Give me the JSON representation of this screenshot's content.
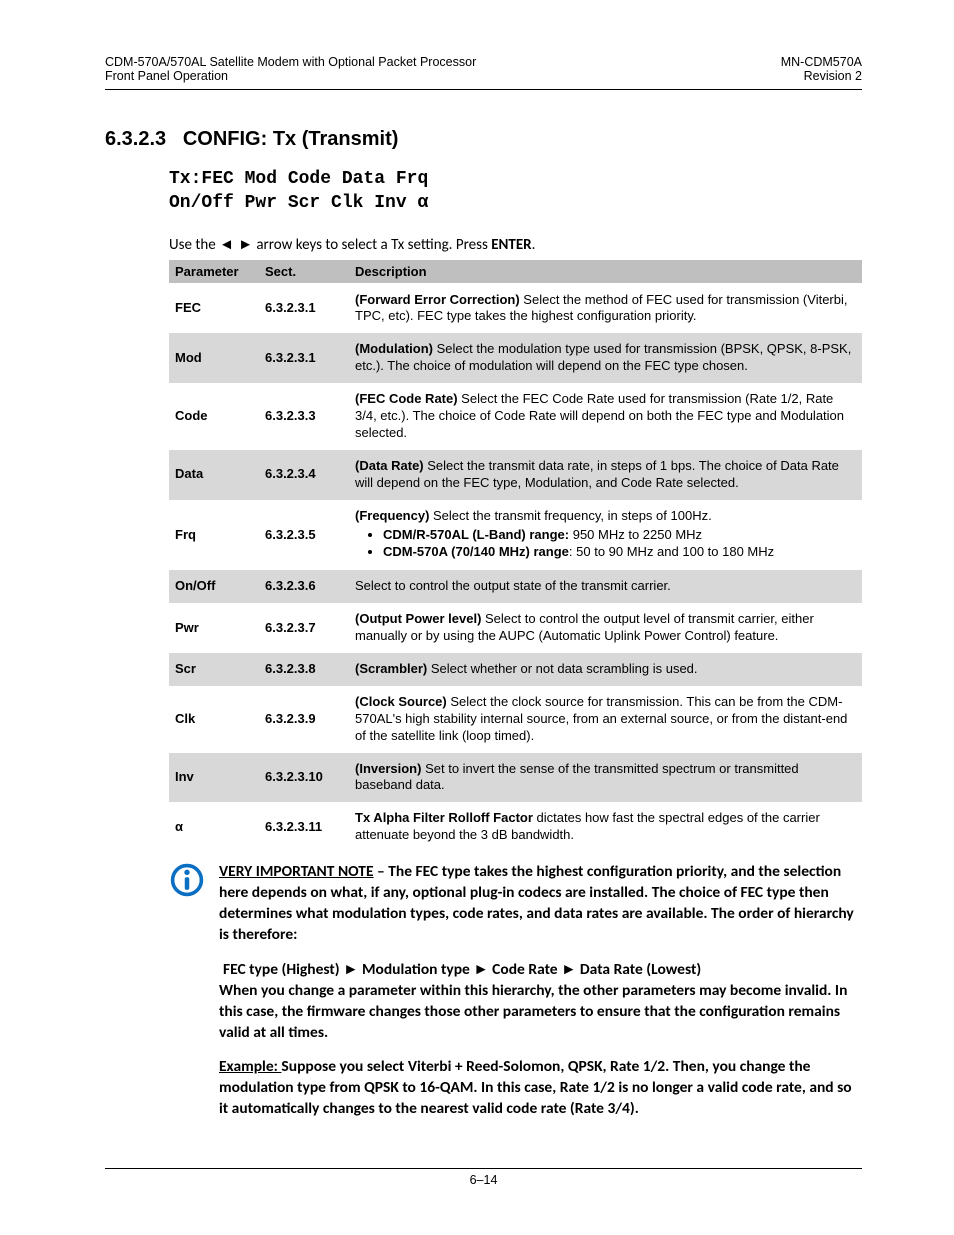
{
  "header": {
    "left_line1": "CDM-570A/570AL Satellite Modem with Optional Packet Processor",
    "left_line2": "Front Panel Operation",
    "right_line1": "MN-CDM570A",
    "right_line2": "Revision 2"
  },
  "section": {
    "number": "6.3.2.3",
    "title": "CONFIG: Tx (Transmit)"
  },
  "lcd": {
    "line1": "Tx:FEC Mod Code Data Frq",
    "line2": "On/Off Pwr Scr Clk Inv α"
  },
  "instruction": {
    "pre": "Use the ",
    "arrows": "◄ ►",
    "mid": " arrow keys to select a Tx setting. Press ",
    "enter": "ENTER",
    "post": "."
  },
  "table": {
    "headers": {
      "param": "Parameter",
      "sect": "Sect.",
      "desc": "Description"
    },
    "rows": [
      {
        "param": "FEC",
        "sect": "6.3.2.3.1",
        "bold": "(Forward Error Correction) ",
        "text": "Select the method of FEC used for transmission (Viterbi, TPC, etc). FEC type takes the highest configuration priority."
      },
      {
        "param": "Mod",
        "sect": "6.3.2.3.1",
        "bold": "(Modulation) ",
        "text": "Select the modulation type used for transmission (BPSK, QPSK, 8-PSK, etc.). The choice of modulation will depend on the FEC type chosen."
      },
      {
        "param": "Code",
        "sect": "6.3.2.3.3",
        "bold": "(FEC Code Rate) ",
        "text": "Select the FEC Code Rate used for transmission (Rate 1/2, Rate 3/4, etc.). The choice of Code Rate will depend on both the FEC type and Modulation selected."
      },
      {
        "param": "Data",
        "sect": "6.3.2.3.4",
        "bold": "(Data Rate) ",
        "text": "Select the transmit data rate, in steps of 1 bps. The choice of Data Rate will depend on the FEC type, Modulation, and Code Rate selected."
      },
      {
        "param": "Frq",
        "sect": "6.3.2.3.5",
        "bold": "(Frequency) ",
        "text": "Select the transmit frequency, in steps of 100Hz.",
        "bullets": [
          {
            "b": "CDM/R-570AL (L-Band) range: ",
            "t": "950 MHz to 2250 MHz"
          },
          {
            "b": "CDM-570A (70/140 MHz) range",
            "t": ": 50 to 90 MHz and 100 to 180 MHz"
          }
        ]
      },
      {
        "param": "On/Off",
        "sect": "6.3.2.3.6",
        "bold": "",
        "text": "Select to control the output state of the transmit carrier."
      },
      {
        "param": "Pwr",
        "sect": "6.3.2.3.7",
        "bold": "(Output Power level) ",
        "text": "Select to control the output level of transmit carrier, either manually or by using the AUPC (Automatic Uplink Power Control) feature."
      },
      {
        "param": "Scr",
        "sect": "6.3.2.3.8",
        "bold": "(Scrambler) ",
        "text": "Select whether or not data scrambling is used."
      },
      {
        "param": "Clk",
        "sect": "6.3.2.3.9",
        "bold": "(Clock Source) ",
        "text": "Select the clock source for transmission. This can be from the CDM-570AL's high stability internal source, from an external source, or from the distant-end of the satellite link (loop timed)."
      },
      {
        "param": "Inv",
        "sect": "6.3.2.3.10",
        "bold": "(Inversion) ",
        "text": "Set to invert the sense of the transmitted spectrum or transmitted baseband data."
      },
      {
        "param": "α",
        "sect": "6.3.2.3.11",
        "bold": "Tx Alpha Filter Rolloff Factor ",
        "text": "dictates how fast the spectral edges of the carrier attenuate beyond the 3 dB bandwidth."
      }
    ]
  },
  "note": {
    "p1_label": "VERY IMPORTANT NOTE",
    "p1_rest": " – The FEC type takes the highest configuration priority, and the selection here depends on what, if any, optional plug-in codecs are installed. The choice of FEC type then determines what modulation types, code rates, and data rates are available. The order of hierarchy is therefore:",
    "hierarchy": "FEC type (Highest)  ►  Modulation type  ►  Code Rate  ►  Data Rate (Lowest)",
    "p2": "When you change a parameter within this hierarchy, the other parameters may become invalid. In this case, the firmware changes those other parameters to ensure that the configuration remains valid at all times.",
    "p3_label": "Example: ",
    "p3_rest": "Suppose you select Viterbi + Reed-Solomon, QPSK, Rate 1/2. Then, you change the modulation type from QPSK to 16-QAM. In this case, Rate 1/2 is no longer a valid code rate, and so it automatically changes to the nearest valid code rate (Rate 3/4)."
  },
  "footer": "6–14"
}
